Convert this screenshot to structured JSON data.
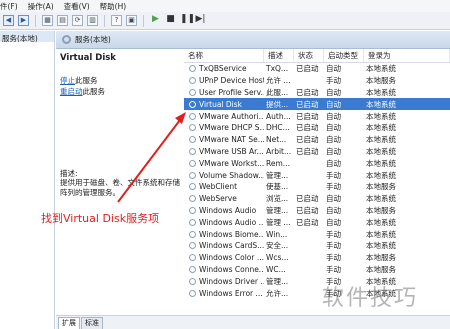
{
  "menubar": {
    "items": [
      "件(F)",
      "操作(A)",
      "查看(V)",
      "帮助(H)"
    ]
  },
  "toolbar": {
    "play": "▶",
    "stop": "■",
    "pause": "❚❚",
    "restart": "▶|"
  },
  "tree": {
    "root": "服务(本地)"
  },
  "header": {
    "title": "服务(本地)"
  },
  "detail": {
    "title": "Virtual Disk",
    "stop_link": "停止",
    "stop_suffix": "此服务",
    "restart_link": "重启动",
    "restart_suffix": "此服务",
    "desc_label": "描述:",
    "desc_text": "提供用于磁盘、卷、文件系统和存储阵列的管理服务。"
  },
  "list": {
    "columns": [
      "名称",
      "描述",
      "状态",
      "启动类型",
      "登录为"
    ],
    "rows": [
      {
        "name": "TxQBService",
        "desc": "TxQ...",
        "status": "已启动",
        "start": "自动",
        "logon": "本地系统"
      },
      {
        "name": "UPnP Device Host",
        "desc": "允许 ...",
        "status": "",
        "start": "手动",
        "logon": "本地服务"
      },
      {
        "name": "User Profile Serv...",
        "desc": "此服...",
        "status": "已启动",
        "start": "自动",
        "logon": "本地系统"
      },
      {
        "name": "Virtual Disk",
        "desc": "提供...",
        "status": "已启动",
        "start": "自动",
        "logon": "本地系统"
      },
      {
        "name": "VMware Authori...",
        "desc": "Auth...",
        "status": "已启动",
        "start": "自动",
        "logon": "本地系统"
      },
      {
        "name": "VMware DHCP S...",
        "desc": "DHC...",
        "status": "已启动",
        "start": "自动",
        "logon": "本地系统"
      },
      {
        "name": "VMware NAT Se...",
        "desc": "Net...",
        "status": "已启动",
        "start": "自动",
        "logon": "本地系统"
      },
      {
        "name": "VMware USB Ar...",
        "desc": "Arbit...",
        "status": "已启动",
        "start": "自动",
        "logon": "本地系统"
      },
      {
        "name": "VMware Workst...",
        "desc": "Rem...",
        "status": "",
        "start": "自动",
        "logon": "本地系统"
      },
      {
        "name": "Volume Shadow...",
        "desc": "管理...",
        "status": "",
        "start": "手动",
        "logon": "本地系统"
      },
      {
        "name": "WebClient",
        "desc": "使基...",
        "status": "",
        "start": "手动",
        "logon": "本地服务"
      },
      {
        "name": "WebServe",
        "desc": "浏览...",
        "status": "已启动",
        "start": "自动",
        "logon": "本地系统"
      },
      {
        "name": "Windows Audio",
        "desc": "管理...",
        "status": "已启动",
        "start": "自动",
        "logon": "本地服务"
      },
      {
        "name": "Windows Audio ...",
        "desc": "管理 ...",
        "status": "已启动",
        "start": "自动",
        "logon": "本地系统"
      },
      {
        "name": "Windows Biome...",
        "desc": "Win...",
        "status": "",
        "start": "手动",
        "logon": "本地系统"
      },
      {
        "name": "Windows CardS...",
        "desc": "安全...",
        "status": "",
        "start": "手动",
        "logon": "本地系统"
      },
      {
        "name": "Windows Color ...",
        "desc": "Wcs...",
        "status": "",
        "start": "手动",
        "logon": "本地服务"
      },
      {
        "name": "Windows Conne...",
        "desc": "WC...",
        "status": "",
        "start": "手动",
        "logon": "本地服务"
      },
      {
        "name": "Windows Driver ...",
        "desc": "管理...",
        "status": "",
        "start": "手动",
        "logon": "本地系统"
      },
      {
        "name": "Windows Error ...",
        "desc": "允许...",
        "status": "",
        "start": "手动",
        "logon": "本地系统"
      }
    ]
  },
  "tabs": [
    "扩展",
    "标准"
  ],
  "annotation": "找到Virtual Disk服务项",
  "watermark": "软件技巧",
  "colors": {
    "accent_red": "#e02020",
    "selection": "#3a7ad0"
  }
}
